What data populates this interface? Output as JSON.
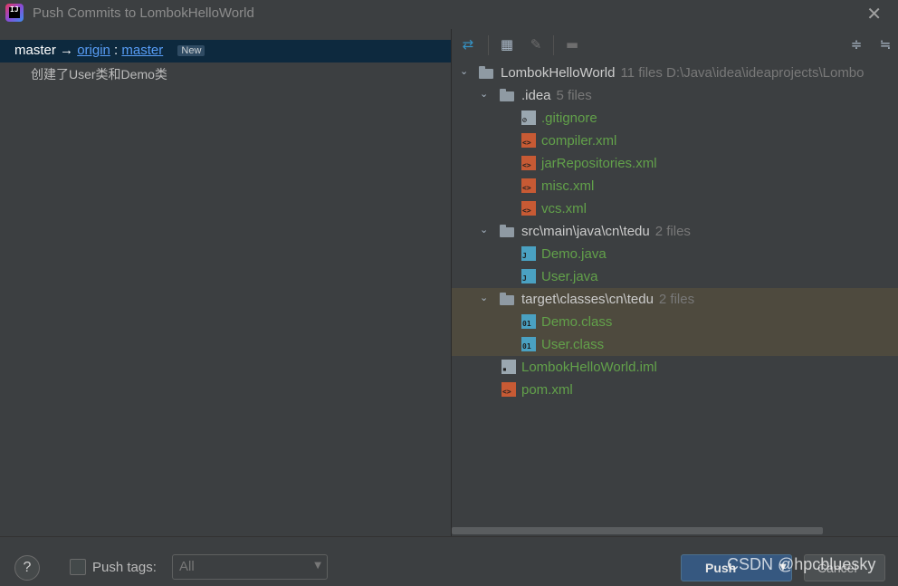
{
  "window": {
    "title": "Push Commits to LombokHelloWorld"
  },
  "left": {
    "branch": {
      "local": "master",
      "arrow": "→",
      "remote": "origin",
      "colon": ":",
      "target": "master",
      "badge": "New"
    },
    "commit": "创建了User类和Demo类"
  },
  "tree": {
    "root": {
      "name": "LombokHelloWorld",
      "meta": "11 files  D:\\Java\\idea\\ideaprojects\\Lombo"
    },
    "idea": {
      "name": ".idea",
      "meta": "5 files",
      "files": [
        ".gitignore",
        "compiler.xml",
        "jarRepositories.xml",
        "misc.xml",
        "vcs.xml"
      ]
    },
    "src": {
      "name": "src\\main\\java\\cn\\tedu",
      "meta": "2 files",
      "files": [
        "Demo.java",
        "User.java"
      ]
    },
    "target": {
      "name": "target\\classes\\cn\\tedu",
      "meta": "2 files",
      "files": [
        "Demo.class",
        "User.class"
      ]
    },
    "root_files": [
      "LombokHelloWorld.iml",
      "pom.xml"
    ]
  },
  "bottom": {
    "help": "?",
    "push_tags_label": "Push tags:",
    "tags_select": "All",
    "push_label": "Push",
    "cancel_label": "Cancel",
    "watermark": "CSDN @hpcbluesky"
  }
}
